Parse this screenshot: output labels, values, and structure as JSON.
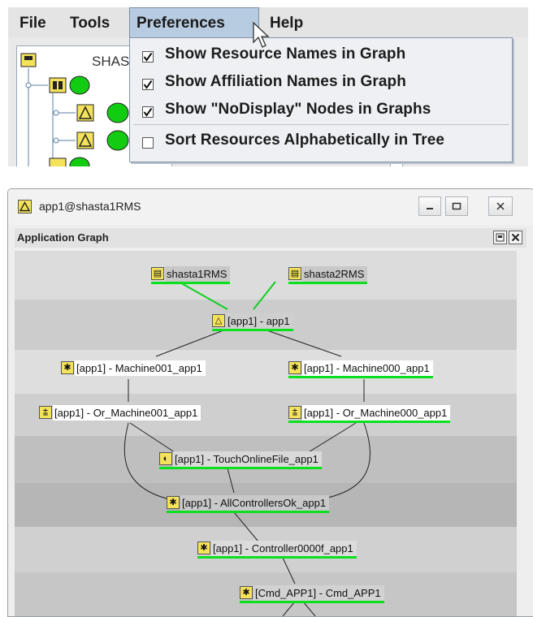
{
  "menu": {
    "items": [
      "File",
      "Tools",
      "Preferences",
      "Help"
    ]
  },
  "tree": {
    "label_partial": "SHAS"
  },
  "preferences_menu": {
    "items": [
      {
        "label": "Show Resource Names in Graph",
        "checked": true
      },
      {
        "label": "Show Affiliation Names in Graph",
        "checked": true
      },
      {
        "label": "Show \"NoDisplay\" Nodes in Graphs",
        "checked": true
      },
      {
        "label": "Sort Resources Alphabetically in Tree",
        "checked": false
      }
    ]
  },
  "window": {
    "title": "app1@shasta1RMS",
    "panel_title": "Application Graph"
  },
  "graph": {
    "nodes": {
      "shasta1": "shasta1RMS",
      "shasta2": "shasta2RMS",
      "app1": "[app1]  -  app1",
      "m001": "[app1]  -  Machine001_app1",
      "m000": "[app1]  -  Machine000_app1",
      "or001": "[app1]  -  Or_Machine001_app1",
      "or000": "[app1]  -  Or_Machine000_app1",
      "touch": "[app1]  -  TouchOnlineFile_app1",
      "allctl": "[app1]  -  AllControllersOk_app1",
      "ctl": "[app1]  -  Controller0000f_app1",
      "cmd": "[Cmd_APP1]  -  Cmd_APP1"
    }
  },
  "colors": {
    "online_line": "#0be01f",
    "node_icon": "#f3e25a",
    "menu_highlight": "#b7cbe1"
  }
}
